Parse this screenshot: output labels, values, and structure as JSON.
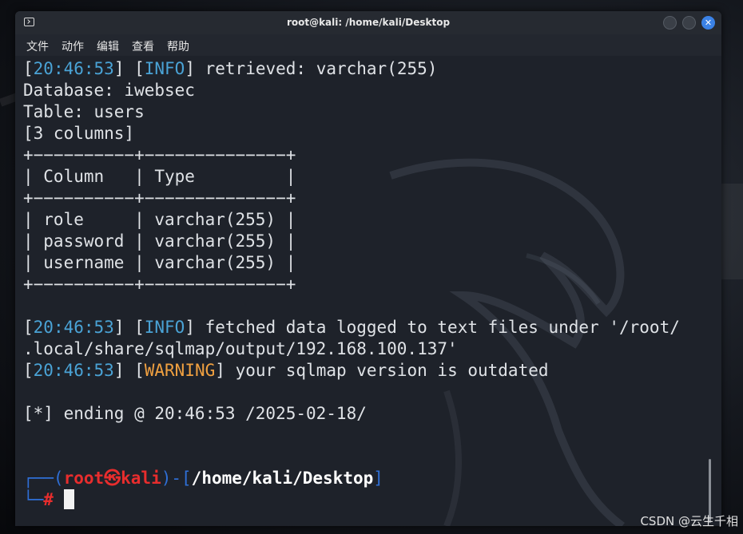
{
  "window": {
    "title": "root@kali: /home/kali/Desktop",
    "close_glyph": "✕"
  },
  "menu": [
    "文件",
    "动作",
    "编辑",
    "查看",
    "帮助"
  ],
  "terminal": {
    "line1": {
      "ts": "20:46:53",
      "level": "INFO",
      "text": " retrieved: varchar(255)"
    },
    "line2": "Database: iwebsec",
    "line3": "Table: users",
    "line4": "[3 columns]",
    "table": {
      "border": "+−−−−−−−−−−+−−−−−−−−−−−−−−+",
      "header": "| Column   | Type         |",
      "rows": [
        "| role     | varchar(255) |",
        "| password | varchar(255) |",
        "| username | varchar(255) |"
      ]
    },
    "line_fetched_1": {
      "ts": "20:46:53",
      "level": "INFO",
      "text": " fetched data logged to text files under '/root/"
    },
    "line_fetched_2": ".local/share/sqlmap/output/192.168.100.137'",
    "line_warning": {
      "ts": "20:46:53",
      "level": "WARNING",
      "text": " your sqlmap version is outdated"
    },
    "line_ending": "[*] ending @ 20:46:53 /2025-02-18/",
    "prompt": {
      "corner_top": "┌──(",
      "user": "root㉿kali",
      "mid": ")-[",
      "path": "/home/kali/Desktop",
      "close": "]",
      "corner_bottom": "└─",
      "hash": "#"
    }
  },
  "watermark": "CSDN @云生千相",
  "colors": {
    "accent_blue": "#4aa3d6",
    "warning": "#f0a040",
    "prompt_red": "#e82d2d",
    "prompt_blue": "#2f6fd6"
  }
}
